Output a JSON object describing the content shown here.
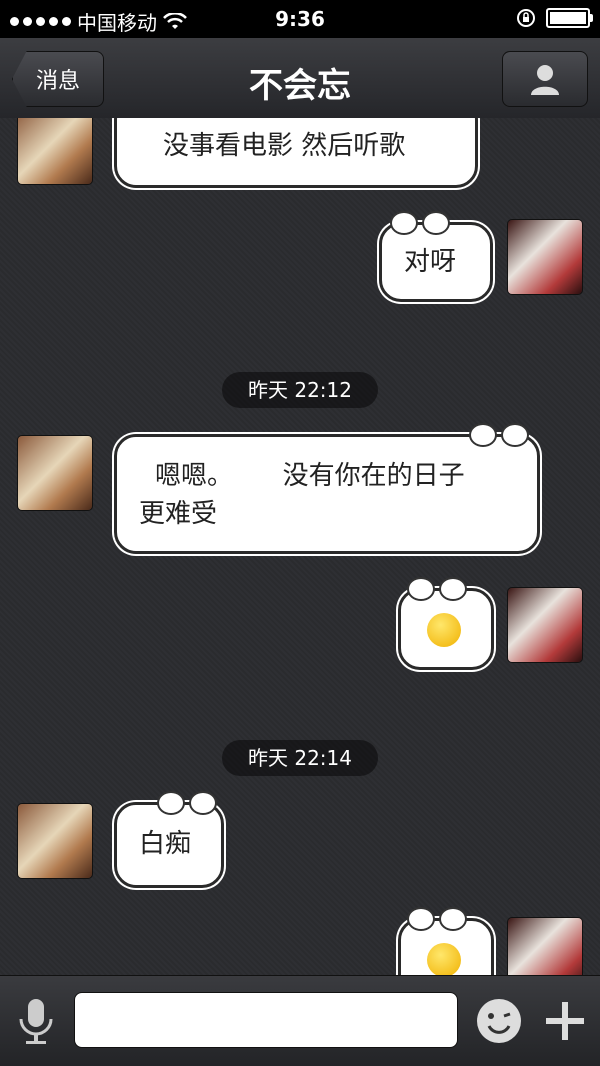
{
  "status_bar": {
    "carrier": "中国移动",
    "time": "9:36"
  },
  "nav": {
    "back_label": "消息",
    "title": "不会忘"
  },
  "messages": [
    {
      "side": "left",
      "text": "没事看电影  然后听歌"
    },
    {
      "side": "right",
      "text": "对呀"
    },
    {
      "type": "timestamp",
      "text": "昨天 22:12"
    },
    {
      "side": "left",
      "text_line1": "嗯嗯。      没有你在的日子",
      "text_line2": "更难受"
    },
    {
      "side": "right",
      "emoji": "smirk-emoji"
    },
    {
      "type": "timestamp",
      "text": "昨天 22:14"
    },
    {
      "side": "left",
      "text": "白痴"
    },
    {
      "side": "right",
      "emoji": "smirk-emoji"
    }
  ],
  "input_bar": {
    "placeholder": ""
  },
  "icons": {
    "wifi": "wifi-icon",
    "lock": "rotation-lock-icon",
    "battery": "battery-icon",
    "profile": "person-icon",
    "voice": "microphone-icon",
    "emoji": "emoji-icon",
    "plus": "plus-icon"
  },
  "colors": {
    "bubble": "#ffffff",
    "background": "#2b2c2f",
    "nav": "#2f3034"
  }
}
